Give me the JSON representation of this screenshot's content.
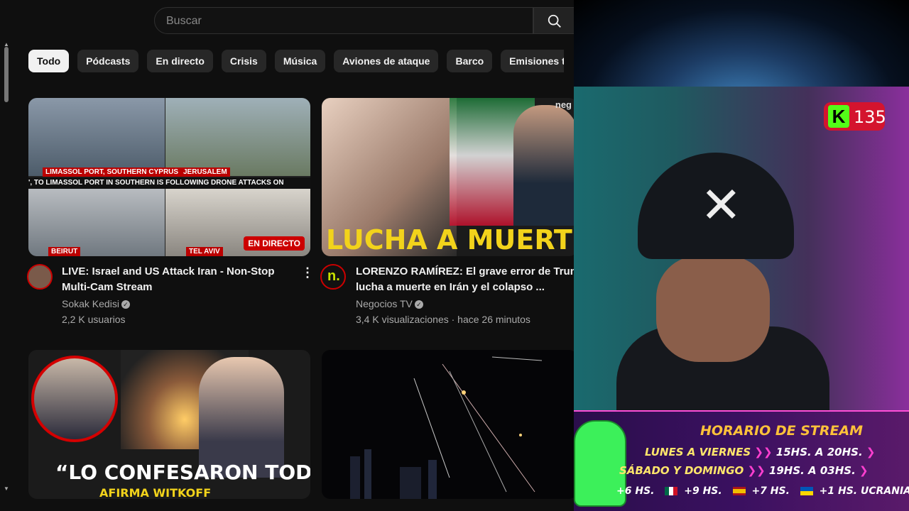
{
  "search": {
    "placeholder": "Buscar"
  },
  "chips": [
    "Todo",
    "Pódcasts",
    "En directo",
    "Crisis",
    "Música",
    "Aviones de ataque",
    "Barco",
    "Emisiones televis"
  ],
  "videos": [
    {
      "title_line1": "LIVE: Israel and US Attack Iran - Non-Stop",
      "title_line2": "Multi-Cam Stream",
      "channel": "Sokak Kedisi",
      "meta": "2,2 K usuarios",
      "badge": "EN DIRECTO",
      "captions": {
        "tl": "LIMASSOL PORT, SOUTHERN CYPRUS",
        "tr": "JERUSALEM",
        "bl": "BEIRUT",
        "br": "TEL AVIV"
      },
      "ticker": "', TO LIMASSOL PORT IN SOUTHERN    IS FOLLOWING DRONE ATTACKS ON"
    },
    {
      "title_line1": "LORENZO RAMÍREZ: El grave error de Trum",
      "title_line2": "lucha a muerte en Irán y el colapso ...",
      "channel": "Negocios TV",
      "meta": "3,4 K visualizaciones · hace 26 minutos",
      "overlay": "LUCHA A MUERT",
      "corner": "neg",
      "avatar_letter": "n."
    },
    {
      "overlay": "“LO CONFESARON TODO”",
      "overlay_sub": "AFIRMA WITKOFF"
    },
    {}
  ],
  "stream": {
    "viewer_count": "135",
    "kick_letter": "K",
    "schedule_title": "HORARIO DE STREAM",
    "rows": [
      {
        "label": "LUNES A VIERNES",
        "time": "15HS. A 20HS."
      },
      {
        "label": "SÁBADO Y DOMINGO",
        "time": "19HS. A 03HS."
      }
    ],
    "timezones": [
      "+6 HS.",
      "+9 HS.",
      "+7 HS.",
      "+1 HS. UCRANIA"
    ]
  },
  "colors": {
    "accent_red": "#cc0000",
    "kick_green": "#53fc18",
    "schedule_gold": "#ffc23a"
  }
}
